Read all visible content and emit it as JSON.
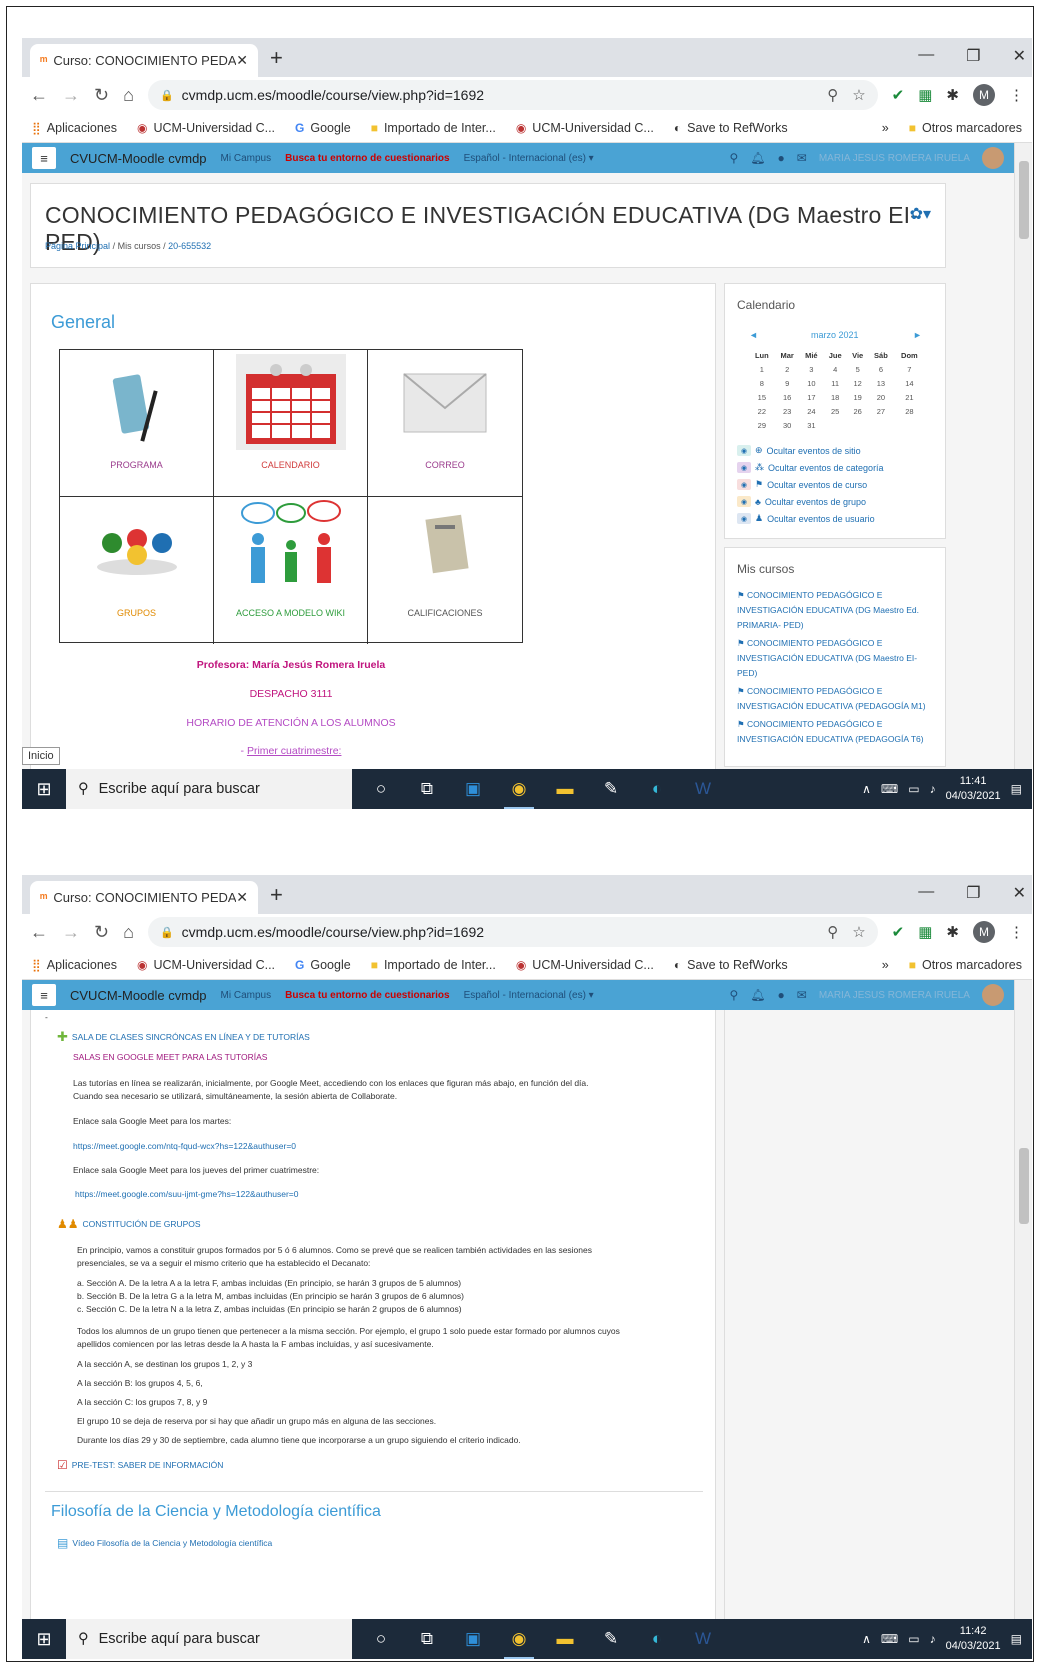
{
  "browser": {
    "tab_title": "Curso: CONOCIMIENTO PEDAGÓ",
    "url": "cvmdp.ucm.es/moodle/course/view.php?id=1692",
    "profile_initial": "M",
    "bookmarks": [
      "Aplicaciones",
      "UCM-Universidad C...",
      "Google",
      "Importado de Inter...",
      "UCM-Universidad C...",
      "Save to RefWorks"
    ],
    "bookmarks_more": "»",
    "bookmarks_other": "Otros marcadores"
  },
  "moodle_nav": {
    "brand": "CVUCM-Moodle cvmdp",
    "campus": "Mi Campus",
    "search_quiz": "Busca tu entorno de cuestionarios",
    "language": "Español - Internacional (es) ▾",
    "user_name": "MARIA JESUS ROMERA IRUELA"
  },
  "course": {
    "title": "CONOCIMIENTO PEDAGÓGICO E INVESTIGACIÓN EDUCATIVA (DG Maestro EI-PED)",
    "breadcrumb": [
      "Página Principal",
      "Mis cursos",
      "20-655532"
    ],
    "section_general": "General",
    "tiles": [
      {
        "label": "PROGRAMA",
        "color": "#9a3b8c"
      },
      {
        "label": "CALENDARIO",
        "color": "#d13c3c"
      },
      {
        "label": "CORREO",
        "color": "#9a3b8c"
      },
      {
        "label": "GRUPOS",
        "color": "#e08a00"
      },
      {
        "label": "ACCESO A MODELO WIKI",
        "color": "#2e9c3c"
      },
      {
        "label": "CALIFICACIONES",
        "color": "#555555"
      }
    ],
    "teacher": "Profesora: María Jesús Romera Iruela",
    "office": "DESPACHO 3111",
    "hours": "HORARIO DE ATENCIÓN A LOS ALUMNOS",
    "first_term": "Primer cuatrimestre:",
    "first_term_prefix": "- "
  },
  "calendar": {
    "title": "Calendario",
    "month": "marzo 2021",
    "prev": "◄",
    "next": "►",
    "weekdays": [
      "Lun",
      "Mar",
      "Mié",
      "Jue",
      "Vie",
      "Sáb",
      "Dom"
    ],
    "weeks": [
      [
        "1",
        "2",
        "3",
        "4",
        "5",
        "6",
        "7"
      ],
      [
        "8",
        "9",
        "10",
        "11",
        "12",
        "13",
        "14"
      ],
      [
        "15",
        "16",
        "17",
        "18",
        "19",
        "20",
        "21"
      ],
      [
        "22",
        "23",
        "24",
        "25",
        "26",
        "27",
        "28"
      ],
      [
        "29",
        "30",
        "31",
        "",
        "",
        "",
        ""
      ]
    ],
    "filters": [
      "Ocultar eventos de sitio",
      "Ocultar eventos de categoría",
      "Ocultar eventos de curso",
      "Ocultar eventos de grupo",
      "Ocultar eventos de usuario"
    ]
  },
  "my_courses": {
    "title": "Mis cursos",
    "items": [
      "CONOCIMIENTO PEDAGÓGICO E INVESTIGACIÓN EDUCATIVA (DG Maestro Ed. PRIMARIA- PED)",
      "CONOCIMIENTO PEDAGÓGICO E INVESTIGACIÓN EDUCATIVA (DG Maestro EI-PED)",
      "CONOCIMIENTO PEDAGÓGICO E INVESTIGACIÓN EDUCATIVA (PEDAGOGÍA M1)",
      "CONOCIMIENTO PEDAGÓGICO E INVESTIGACIÓN EDUCATIVA (PEDAGOGÍA T6)"
    ]
  },
  "tooltip": "Inicio",
  "taskbar": {
    "search_placeholder": "Escribe aquí para buscar",
    "time1": "11:41",
    "time2": "11:42",
    "date": "04/03/2021"
  },
  "section2": {
    "dash": "-",
    "sala_title": "SALA DE CLASES SINCRÓNCAS EN LÍNEA Y DE TUTORÍAS",
    "sala_sub": "SALAS EN GOOGLE MEET PARA LAS TUTORÍAS",
    "p1": "Las tutorías en línea se realizarán, inicialmente, por Google Meet, accediendo con los enlaces que figuran más abajo, en función del día.",
    "p2": "Cuando sea necesario se utilizará, simultáneamente, la sesión abierta de Collaborate.",
    "martes_label": "Enlace sala Google Meet para los martes:",
    "martes_link": "https://meet.google.com/ntq-fqud-wcx?hs=122&authuser=0",
    "jueves_label": "Enlace sala Google Meet para los jueves del primer cuatrimestre:",
    "jueves_link": "https://meet.google.com/suu-ijmt-gme?hs=122&authuser=0",
    "grupos_title": "CONSTITUCIÓN DE GRUPOS",
    "g1": "En principio, vamos a constituir grupos formados por 5 ó 6 alumnos. Como se prevé que se realicen también actividades en las sesiones",
    "g2": "presenciales, se va a seguir el mismo criterio que ha establecido el Decanato:",
    "ga": "a. Sección A. De la letra A a la letra F, ambas incluidas (En principio, se harán 3 grupos de 5 alumnos)",
    "gb": "b. Sección B. De la letra G a la letra M, ambas incluidas (En principio se harán 3 grupos de 6 alumnos)",
    "gc": "c. Sección C. De la letra N a la letra Z, ambas incluidas (En principio se harán 2 grupos de 6 alumnos)",
    "g3": "Todos los alumnos de un grupo tienen que pertenecer a la misma sección. Por ejemplo, el grupo 1 solo puede estar formado por alumnos cuyos",
    "g4": "apellidos comiencen por las letras desde la A hasta la F ambas incluidas, y así sucesivamente.",
    "sa": "A la sección A, se destinan los grupos 1, 2, y 3",
    "sb": "A la sección B: los grupos 4, 5, 6,",
    "sc": "A la sección C: los grupos 7, 8, y 9",
    "g10": "El grupo 10 se deja de reserva por si hay que añadir un grupo más en alguna de las secciones.",
    "g11": "Durante los días 29 y 30 de septiembre, cada alumno tiene que incorporarse a un grupo siguiendo el criterio indicado.",
    "pretest": "PRE-TEST: SABER DE INFORMACIÓN",
    "filo_title": "Filosofía de la Ciencia y Metodología científica",
    "video": "Vídeo Filosofía de la Ciencia y Metodología científica"
  }
}
